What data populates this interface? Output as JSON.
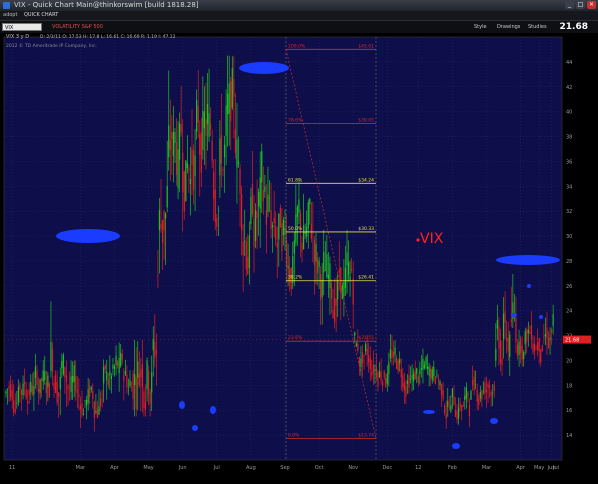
{
  "window": {
    "title": "VIX - Quick Chart Main@thinkorswim [build 1818.28]",
    "close_glyph": "×",
    "maximize_glyph": "□",
    "minimize_glyph": "_"
  },
  "toolbar": {
    "adopt_label": "adopt",
    "quick_chart_label": "QUICK CHART",
    "style_label": "Style",
    "drawings_label": "Drawings",
    "studies_label": "Studies",
    "last_price": "21.68"
  },
  "symbol": {
    "value": "VIX",
    "index_label": "VOLATILITY S&P 500",
    "info": "VIX 3 y D",
    "ohlc": "D: 2/3/11   O: 17.53   H: 17.8   L: 16.61   C: 16.69   R: 1.19   I: 47.12",
    "copyright": "2012 © TD Ameritrade IP Company, Inc."
  },
  "colors": {
    "plot_bg": "#0e0e4a",
    "up": "#1ec41e",
    "down": "#e02020",
    "grid": "#2b2b66",
    "fib": "#e8e440",
    "fib_red": "#d22c2c",
    "marker": "#1a3cff",
    "annotation": "#ff2020"
  },
  "chart_data": {
    "type": "candlestick",
    "title": "VIX",
    "ylabel": "",
    "xlabel": "",
    "ylim": [
      12,
      46
    ],
    "y_ticks": [
      14,
      16,
      18,
      20,
      22,
      24,
      26,
      28,
      30,
      32,
      34,
      36,
      38,
      40,
      42,
      44
    ],
    "x_tick_labels": [
      "11",
      "Mar",
      "Apr",
      "May",
      "Jun",
      "Jul",
      "Aug",
      "Sep",
      "Oct",
      "Nov",
      "Dec",
      "12",
      "Feb",
      "Mar",
      "Apr",
      "May",
      "Jun",
      "Jul"
    ],
    "last_price": 21.68,
    "series": [
      {
        "name": "VIX",
        "segments": [
          {
            "from": 0,
            "to": 20,
            "low": 15.5,
            "high": 21.0
          },
          {
            "from": 20,
            "to": 29,
            "low": 15.5,
            "high": 21.0
          },
          {
            "from": 29,
            "to": 30,
            "low": 16.0,
            "high": 31.5
          },
          {
            "from": 30,
            "to": 40,
            "low": 15.0,
            "high": 24.0
          },
          {
            "from": 40,
            "to": 60,
            "low": 14.0,
            "high": 20.0
          },
          {
            "from": 60,
            "to": 82,
            "low": 15.0,
            "high": 21.5
          },
          {
            "from": 82,
            "to": 98,
            "low": 15.5,
            "high": 27.0
          },
          {
            "from": 98,
            "to": 106,
            "low": 25.0,
            "high": 44.0
          },
          {
            "from": 106,
            "to": 150,
            "low": 30.0,
            "high": 44.5
          },
          {
            "from": 150,
            "to": 170,
            "low": 25.0,
            "high": 38.0
          },
          {
            "from": 170,
            "to": 200,
            "low": 24.0,
            "high": 34.5
          },
          {
            "from": 200,
            "to": 225,
            "low": 21.0,
            "high": 30.5
          },
          {
            "from": 225,
            "to": 255,
            "low": 17.5,
            "high": 22.5
          },
          {
            "from": 255,
            "to": 280,
            "low": 16.5,
            "high": 21.0
          },
          {
            "from": 280,
            "to": 300,
            "low": 14.5,
            "high": 19.0
          },
          {
            "from": 300,
            "to": 315,
            "low": 16.0,
            "high": 21.0
          },
          {
            "from": 315,
            "to": 330,
            "low": 17.0,
            "high": 27.5
          },
          {
            "from": 330,
            "to": 340,
            "low": 19.5,
            "high": 25.0
          }
        ],
        "summary": "Approx. 340 daily bars, Feb 2011 – Jun 2012; spike from ~17 in July 2011 to ~44-45 in Aug/Oct 2011, declining to ~14 in Mar 2012, then rising to ~21.68."
      }
    ],
    "fib_levels": [
      {
        "label": "100.0%",
        "price": "$45.01",
        "value": 45.01
      },
      {
        "label": "78.6%",
        "price": "$39.05",
        "value": 39.05
      },
      {
        "label": "61.8%",
        "price": "$34.24",
        "value": 34.24
      },
      {
        "label": "50.0%",
        "price": "$30.33",
        "value": 30.33
      },
      {
        "label": "38.2%",
        "price": "$26.41",
        "value": 26.41
      },
      {
        "label": "23.6%",
        "price": "$21.55",
        "value": 21.55
      },
      {
        "label": "0.0%",
        "price": "$13.74",
        "value": 13.74
      }
    ],
    "annotations": [
      {
        "text": "VIX"
      }
    ]
  }
}
